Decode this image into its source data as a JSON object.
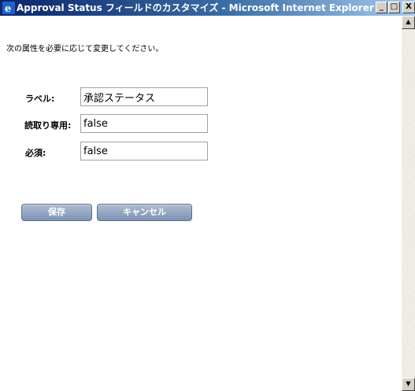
{
  "window": {
    "title": "Approval Status フィールドのカスタマイズ - Microsoft Internet Explorer",
    "icon": "ie-icon",
    "controls": {
      "minimize": "_",
      "maximize": "□",
      "close": "X"
    }
  },
  "form": {
    "instruction": "次の属性を必要に応じて変更してください。",
    "fields": [
      {
        "label": "ラベル:",
        "value": "承認ステータス"
      },
      {
        "label": "読取り専用:",
        "value": "false"
      },
      {
        "label": "必須:",
        "value": "false"
      }
    ]
  },
  "buttons": {
    "save": "保存",
    "cancel": "キャンセル"
  },
  "scrollbar": {
    "up": "▲",
    "down": "▼"
  }
}
